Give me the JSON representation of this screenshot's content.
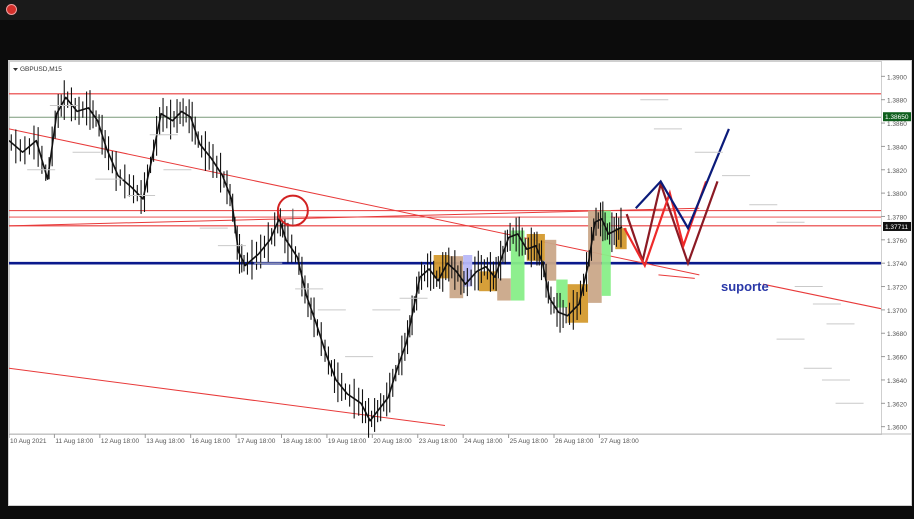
{
  "symbol_label": "GBPUSD,M15",
  "annotation": "suporte",
  "current_price_label": "1.37711",
  "marked_level_label": "1.38650",
  "colors": {
    "candle": "#111111",
    "red_line": "#e83a3a",
    "support": "#0a1a8c",
    "orange_box": "#d49a2e",
    "tan_box": "#caa889",
    "green_box": "#88ee88",
    "lavender_box": "#b8b8f8",
    "navy_zigzag": "#0b1b7a",
    "red_zigzag": "#ee2a2a",
    "maroon_zigzag": "#8b1a24",
    "level_tag": "#0e5e1c"
  },
  "chart_data": {
    "type": "line",
    "title": "",
    "x_tick_labels": [
      "10 Aug 2021",
      "11 Aug 18:00",
      "12 Aug 18:00",
      "13 Aug 18:00",
      "16 Aug 18:00",
      "17 Aug 18:00",
      "18 Aug 18:00",
      "19 Aug 18:00",
      "20 Aug 18:00",
      "23 Aug 18:00",
      "24 Aug 18:00",
      "25 Aug 18:00",
      "26 Aug 18:00",
      "27 Aug 18:00"
    ],
    "y_tick_labels": [
      "1.3900",
      "1.3880",
      "1.3860",
      "1.3840",
      "1.3820",
      "1.3800",
      "1.3780",
      "1.3760",
      "1.3740",
      "1.3720",
      "1.3700",
      "1.3680",
      "1.3660",
      "1.3640",
      "1.3620",
      "1.3600"
    ],
    "ylim": [
      1.3598,
      1.3908
    ],
    "xlim": [
      0,
      13.6
    ],
    "series": [
      {
        "values": [
          [
            0,
            1.3845
          ],
          [
            0.3,
            1.3835
          ],
          [
            0.6,
            1.3845
          ],
          [
            0.85,
            1.3812
          ],
          [
            1.05,
            1.3868
          ],
          [
            1.25,
            1.3882
          ],
          [
            1.5,
            1.387
          ],
          [
            1.75,
            1.3873
          ],
          [
            1.95,
            1.3862
          ],
          [
            2.15,
            1.3838
          ],
          [
            2.4,
            1.3815
          ],
          [
            2.7,
            1.3805
          ],
          [
            2.95,
            1.3795
          ],
          [
            3.15,
            1.383
          ],
          [
            3.35,
            1.3868
          ],
          [
            3.6,
            1.3862
          ],
          [
            3.8,
            1.387
          ],
          [
            4.0,
            1.3865
          ],
          [
            4.2,
            1.3842
          ],
          [
            4.45,
            1.383
          ],
          [
            4.7,
            1.3815
          ],
          [
            4.9,
            1.3795
          ],
          [
            5.05,
            1.375
          ],
          [
            5.2,
            1.3738
          ],
          [
            5.5,
            1.3748
          ],
          [
            5.75,
            1.376
          ],
          [
            5.95,
            1.3778
          ],
          [
            6.1,
            1.376
          ],
          [
            6.35,
            1.3745
          ],
          [
            6.55,
            1.3712
          ],
          [
            6.75,
            1.369
          ],
          [
            7.0,
            1.366
          ],
          [
            7.2,
            1.364
          ],
          [
            7.45,
            1.3628
          ],
          [
            7.75,
            1.362
          ],
          [
            7.95,
            1.3605
          ],
          [
            8.15,
            1.3615
          ],
          [
            8.35,
            1.3625
          ],
          [
            8.55,
            1.365
          ],
          [
            8.75,
            1.3672
          ],
          [
            8.9,
            1.37
          ],
          [
            9.05,
            1.3728
          ],
          [
            9.25,
            1.3735
          ],
          [
            9.45,
            1.3725
          ],
          [
            9.65,
            1.374
          ],
          [
            9.85,
            1.3733
          ],
          [
            10.05,
            1.3722
          ],
          [
            10.3,
            1.3733
          ],
          [
            10.5,
            1.3737
          ],
          [
            10.7,
            1.3728
          ],
          [
            10.85,
            1.3745
          ],
          [
            11.0,
            1.3762
          ],
          [
            11.2,
            1.3765
          ],
          [
            11.4,
            1.3752
          ],
          [
            11.6,
            1.3755
          ],
          [
            11.75,
            1.374
          ],
          [
            11.9,
            1.371
          ],
          [
            12.1,
            1.3698
          ],
          [
            12.3,
            1.3695
          ],
          [
            12.55,
            1.3705
          ],
          [
            12.75,
            1.3738
          ],
          [
            12.9,
            1.3775
          ],
          [
            13.05,
            1.3778
          ],
          [
            13.2,
            1.3765
          ],
          [
            13.35,
            1.3768
          ],
          [
            13.5,
            1.3771
          ]
        ]
      }
    ],
    "horizontal_levels": [
      1.3885,
      1.3865,
      1.3785,
      1.3772,
      1.374
    ],
    "support_level": 1.374,
    "trendlines": [
      {
        "from": [
          0,
          1.3855
        ],
        "to": [
          15.2,
          1.373
        ]
      },
      {
        "from": [
          0,
          1.3772
        ],
        "to": [
          15.2,
          1.3787
        ]
      },
      {
        "from": [
          0,
          1.365
        ],
        "to": [
          9.6,
          1.3601
        ]
      }
    ],
    "boxes": [
      {
        "kind": "orange",
        "x": [
          9.35,
          9.7
        ],
        "y": [
          1.3727,
          1.3747
        ]
      },
      {
        "kind": "tan",
        "x": [
          9.7,
          10.0
        ],
        "y": [
          1.371,
          1.3746
        ]
      },
      {
        "kind": "lavender",
        "x": [
          10.0,
          10.2
        ],
        "y": [
          1.372,
          1.3747
        ]
      },
      {
        "kind": "orange",
        "x": [
          10.35,
          10.75
        ],
        "y": [
          1.3716,
          1.3733
        ]
      },
      {
        "kind": "tan",
        "x": [
          10.75,
          11.05
        ],
        "y": [
          1.3708,
          1.3727
        ]
      },
      {
        "kind": "green",
        "x": [
          11.05,
          11.35
        ],
        "y": [
          1.3708,
          1.3768
        ]
      },
      {
        "kind": "orange",
        "x": [
          11.4,
          11.8
        ],
        "y": [
          1.3742,
          1.3765
        ]
      },
      {
        "kind": "tan",
        "x": [
          11.8,
          12.05
        ],
        "y": [
          1.3725,
          1.376
        ]
      },
      {
        "kind": "green",
        "x": [
          12.05,
          12.3
        ],
        "y": [
          1.3702,
          1.3726
        ]
      },
      {
        "kind": "orange",
        "x": [
          12.3,
          12.75
        ],
        "y": [
          1.3689,
          1.3722
        ]
      },
      {
        "kind": "tan",
        "x": [
          12.75,
          13.05
        ],
        "y": [
          1.3706,
          1.3785
        ]
      },
      {
        "kind": "green",
        "x": [
          13.05,
          13.25
        ],
        "y": [
          1.3712,
          1.3785
        ]
      },
      {
        "kind": "orange",
        "x": [
          13.35,
          13.6
        ],
        "y": [
          1.3752,
          1.377
        ]
      }
    ],
    "zigzags": [
      {
        "color": "maroon",
        "points": [
          [
            13.6,
            1.3782
          ],
          [
            13.95,
            1.3742
          ],
          [
            14.35,
            1.3808
          ],
          [
            14.95,
            1.374
          ],
          [
            15.6,
            1.381
          ]
        ]
      },
      {
        "color": "red",
        "points": [
          [
            13.55,
            1.377
          ],
          [
            14.0,
            1.3738
          ],
          [
            14.55,
            1.38
          ],
          [
            14.85,
            1.3755
          ],
          [
            15.35,
            1.381
          ]
        ]
      },
      {
        "color": "navy",
        "points": [
          [
            13.8,
            1.3787
          ],
          [
            14.35,
            1.381
          ],
          [
            14.95,
            1.377
          ],
          [
            15.85,
            1.3855
          ]
        ]
      }
    ],
    "highlight_circle": {
      "x": 6.25,
      "y": 1.3785
    }
  }
}
